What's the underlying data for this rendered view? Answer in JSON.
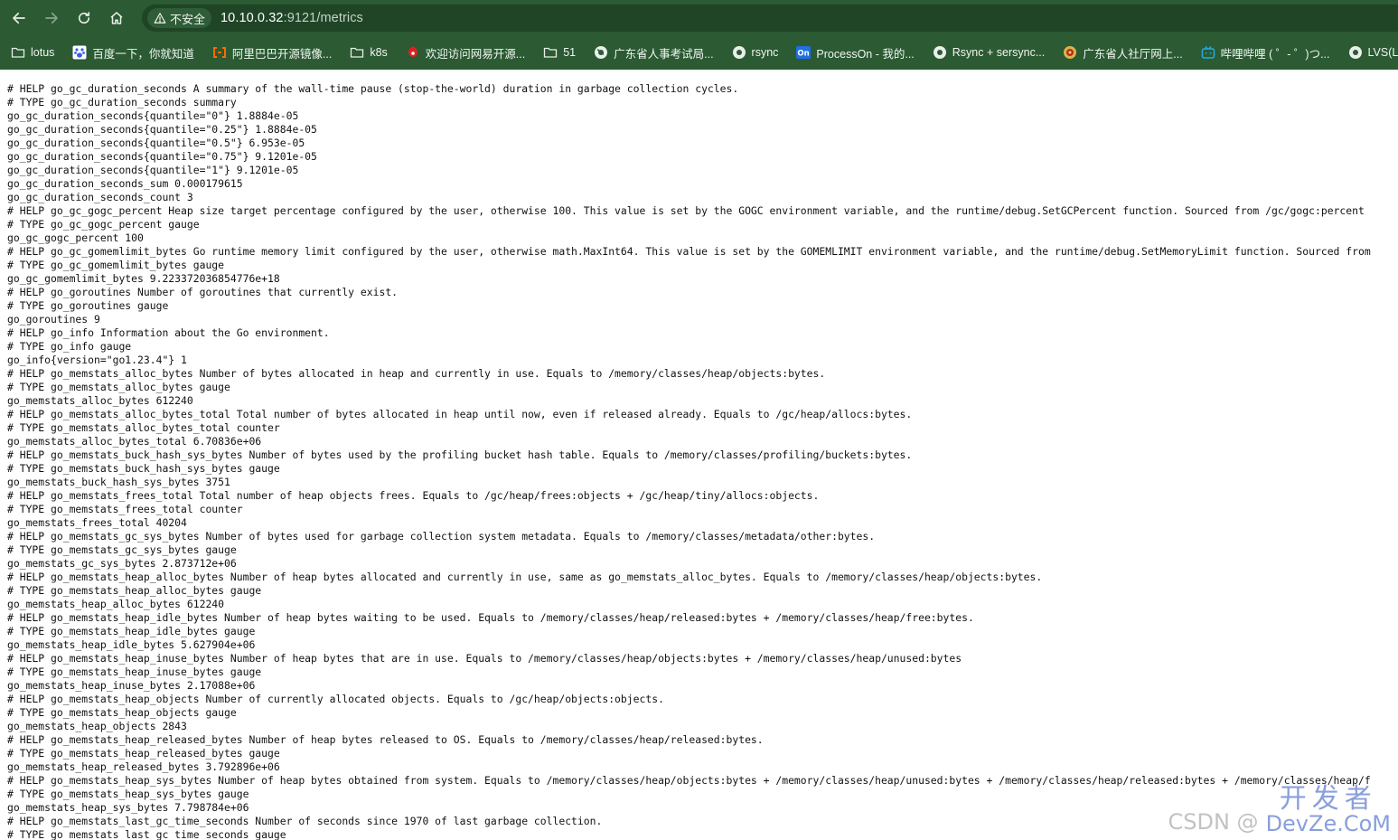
{
  "browser": {
    "security_label": "不安全",
    "url_host": "10.10.0.32",
    "url_rest": ":9121/metrics",
    "bookmarks": [
      {
        "label": "lotus",
        "icon": "folder-icon"
      },
      {
        "label": "百度一下，你就知道",
        "icon": "baidu-paw-icon"
      },
      {
        "label": "阿里巴巴开源镜像...",
        "icon": "aliyun-icon"
      },
      {
        "label": "k8s",
        "icon": "folder-icon"
      },
      {
        "label": "欢迎访问网易开源...",
        "icon": "netease-icon"
      },
      {
        "label": "51",
        "icon": "folder-icon"
      },
      {
        "label": "广东省人事考试局...",
        "icon": "globe-icon"
      },
      {
        "label": "rsync",
        "icon": "globe-icon"
      },
      {
        "label": "ProcessOn - 我的...",
        "icon": "processon-icon"
      },
      {
        "label": "Rsync + sersync...",
        "icon": "globe-icon"
      },
      {
        "label": "广东省人社厅网上...",
        "icon": "gov-emblem-icon"
      },
      {
        "label": "哔哩哔哩 ( ゜- ゜)つ...",
        "icon": "bilibili-icon"
      },
      {
        "label": "LVS(Linux",
        "icon": "globe-icon"
      }
    ]
  },
  "page": {
    "lines": [
      "# HELP go_gc_duration_seconds A summary of the wall-time pause (stop-the-world) duration in garbage collection cycles.",
      "# TYPE go_gc_duration_seconds summary",
      "go_gc_duration_seconds{quantile=\"0\"} 1.8884e-05",
      "go_gc_duration_seconds{quantile=\"0.25\"} 1.8884e-05",
      "go_gc_duration_seconds{quantile=\"0.5\"} 6.953e-05",
      "go_gc_duration_seconds{quantile=\"0.75\"} 9.1201e-05",
      "go_gc_duration_seconds{quantile=\"1\"} 9.1201e-05",
      "go_gc_duration_seconds_sum 0.000179615",
      "go_gc_duration_seconds_count 3",
      "# HELP go_gc_gogc_percent Heap size target percentage configured by the user, otherwise 100. This value is set by the GOGC environment variable, and the runtime/debug.SetGCPercent function. Sourced from /gc/gogc:percent",
      "# TYPE go_gc_gogc_percent gauge",
      "go_gc_gogc_percent 100",
      "# HELP go_gc_gomemlimit_bytes Go runtime memory limit configured by the user, otherwise math.MaxInt64. This value is set by the GOMEMLIMIT environment variable, and the runtime/debug.SetMemoryLimit function. Sourced from",
      "# TYPE go_gc_gomemlimit_bytes gauge",
      "go_gc_gomemlimit_bytes 9.223372036854776e+18",
      "# HELP go_goroutines Number of goroutines that currently exist.",
      "# TYPE go_goroutines gauge",
      "go_goroutines 9",
      "# HELP go_info Information about the Go environment.",
      "# TYPE go_info gauge",
      "go_info{version=\"go1.23.4\"} 1",
      "# HELP go_memstats_alloc_bytes Number of bytes allocated in heap and currently in use. Equals to /memory/classes/heap/objects:bytes.",
      "# TYPE go_memstats_alloc_bytes gauge",
      "go_memstats_alloc_bytes 612240",
      "# HELP go_memstats_alloc_bytes_total Total number of bytes allocated in heap until now, even if released already. Equals to /gc/heap/allocs:bytes.",
      "# TYPE go_memstats_alloc_bytes_total counter",
      "go_memstats_alloc_bytes_total 6.70836e+06",
      "# HELP go_memstats_buck_hash_sys_bytes Number of bytes used by the profiling bucket hash table. Equals to /memory/classes/profiling/buckets:bytes.",
      "# TYPE go_memstats_buck_hash_sys_bytes gauge",
      "go_memstats_buck_hash_sys_bytes 3751",
      "# HELP go_memstats_frees_total Total number of heap objects frees. Equals to /gc/heap/frees:objects + /gc/heap/tiny/allocs:objects.",
      "# TYPE go_memstats_frees_total counter",
      "go_memstats_frees_total 40204",
      "# HELP go_memstats_gc_sys_bytes Number of bytes used for garbage collection system metadata. Equals to /memory/classes/metadata/other:bytes.",
      "# TYPE go_memstats_gc_sys_bytes gauge",
      "go_memstats_gc_sys_bytes 2.873712e+06",
      "# HELP go_memstats_heap_alloc_bytes Number of heap bytes allocated and currently in use, same as go_memstats_alloc_bytes. Equals to /memory/classes/heap/objects:bytes.",
      "# TYPE go_memstats_heap_alloc_bytes gauge",
      "go_memstats_heap_alloc_bytes 612240",
      "# HELP go_memstats_heap_idle_bytes Number of heap bytes waiting to be used. Equals to /memory/classes/heap/released:bytes + /memory/classes/heap/free:bytes.",
      "# TYPE go_memstats_heap_idle_bytes gauge",
      "go_memstats_heap_idle_bytes 5.627904e+06",
      "# HELP go_memstats_heap_inuse_bytes Number of heap bytes that are in use. Equals to /memory/classes/heap/objects:bytes + /memory/classes/heap/unused:bytes",
      "# TYPE go_memstats_heap_inuse_bytes gauge",
      "go_memstats_heap_inuse_bytes 2.17088e+06",
      "# HELP go_memstats_heap_objects Number of currently allocated objects. Equals to /gc/heap/objects:objects.",
      "# TYPE go_memstats_heap_objects gauge",
      "go_memstats_heap_objects 2843",
      "# HELP go_memstats_heap_released_bytes Number of heap bytes released to OS. Equals to /memory/classes/heap/released:bytes.",
      "# TYPE go_memstats_heap_released_bytes gauge",
      "go_memstats_heap_released_bytes 3.792896e+06",
      "# HELP go_memstats_heap_sys_bytes Number of heap bytes obtained from system. Equals to /memory/classes/heap/objects:bytes + /memory/classes/heap/unused:bytes + /memory/classes/heap/released:bytes + /memory/classes/heap/f",
      "# TYPE go_memstats_heap_sys_bytes gauge",
      "go_memstats_heap_sys_bytes 7.798784e+06",
      "# HELP go_memstats_last_gc_time_seconds Number of seconds since 1970 of last garbage collection.",
      "# TYPE go_memstats_last_gc_time_seconds gauge"
    ]
  },
  "watermark": {
    "left": "CSDN @",
    "logo_cn": "开发者",
    "logo_en": "DevZe.CoM"
  },
  "colors": {
    "toolbar_bg": "#2b5a33",
    "omnibox_bg": "#1f4526",
    "text": "#111111"
  }
}
